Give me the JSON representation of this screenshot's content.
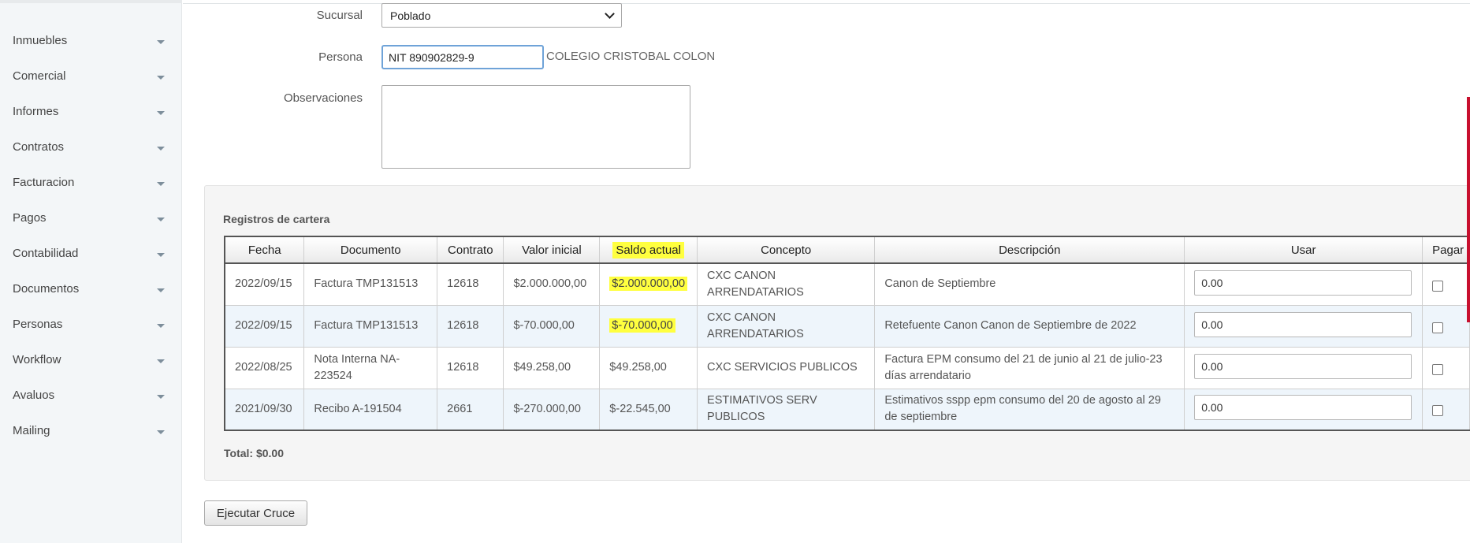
{
  "sidebar": {
    "items": [
      {
        "label": "Inmuebles"
      },
      {
        "label": "Comercial"
      },
      {
        "label": "Informes"
      },
      {
        "label": "Contratos"
      },
      {
        "label": "Facturacion"
      },
      {
        "label": "Pagos"
      },
      {
        "label": "Contabilidad"
      },
      {
        "label": "Documentos"
      },
      {
        "label": "Personas"
      },
      {
        "label": "Workflow"
      },
      {
        "label": "Avaluos"
      },
      {
        "label": "Mailing"
      }
    ]
  },
  "form": {
    "sucursal_label": "Sucursal",
    "sucursal_value": "Poblado",
    "persona_label": "Persona",
    "persona_value": "NIT 890902829-9",
    "persona_name": "COLEGIO CRISTOBAL COLON",
    "observaciones_label": "Observaciones",
    "observaciones_value": ""
  },
  "cartera": {
    "title": "Registros de cartera",
    "columns": [
      "Fecha",
      "Documento",
      "Contrato",
      "Valor inicial",
      "Saldo actual",
      "Concepto",
      "Descripción",
      "Usar",
      "Pagar"
    ],
    "rows": [
      {
        "fecha": "2022/09/15",
        "documento": "Factura TMP131513",
        "contrato": "12618",
        "valor_inicial": "$2.000.000,00",
        "saldo_actual": "$2.000.000,00",
        "concepto": "CXC CANON ARRENDATARIOS",
        "descripcion": "Canon de Septiembre",
        "usar": "0.00"
      },
      {
        "fecha": "2022/09/15",
        "documento": "Factura TMP131513",
        "contrato": "12618",
        "valor_inicial": "$-70.000,00",
        "saldo_actual": "$-70.000,00",
        "concepto": "CXC CANON ARRENDATARIOS",
        "descripcion": "Retefuente Canon Canon de Septiembre de 2022",
        "usar": "0.00"
      },
      {
        "fecha": "2022/08/25",
        "documento": "Nota Interna NA-223524",
        "contrato": "12618",
        "valor_inicial": "$49.258,00",
        "saldo_actual": "$49.258,00",
        "concepto": "CXC SERVICIOS PUBLICOS",
        "descripcion": "Factura EPM consumo del 21 de junio al 21 de julio-23 días arrendatario",
        "usar": "0.00"
      },
      {
        "fecha": "2021/09/30",
        "documento": "Recibo A-191504",
        "contrato": "2661",
        "valor_inicial": "$-270.000,00",
        "saldo_actual": "$-22.545,00",
        "concepto": "ESTIMATIVOS SERV PUBLICOS",
        "descripcion": "Estimativos sspp epm consumo del 20 de agosto al 29 de septiembre",
        "usar": "0.00"
      }
    ],
    "total": "Total: $0.00"
  },
  "actions": {
    "execute_label": "Ejecutar Cruce"
  },
  "colors": {
    "highlight": "#ffff3f",
    "accent_bar": "#c8102e",
    "row_alt": "#eef5fb"
  }
}
